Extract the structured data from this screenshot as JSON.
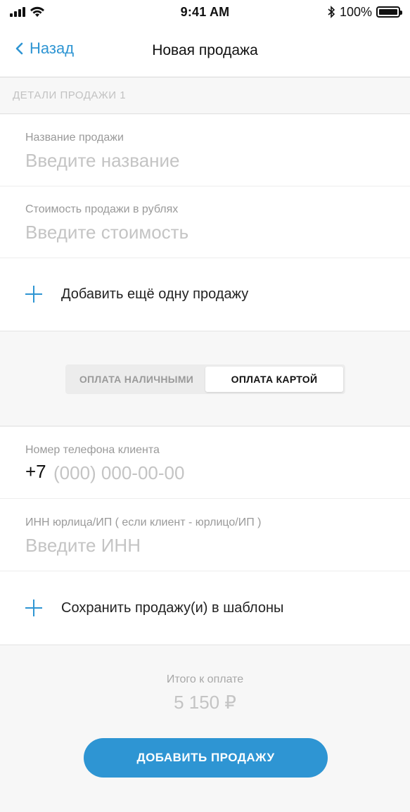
{
  "status_bar": {
    "time": "9:41 AM",
    "battery": "100%",
    "battery_level": 1.0
  },
  "nav": {
    "back_label": "Назад",
    "title": "Новая продажа"
  },
  "section": {
    "title": "ДЕТАЛИ ПРОДАЖИ 1"
  },
  "form": {
    "name": {
      "label": "Название продажи",
      "placeholder": "Введите название",
      "value": ""
    },
    "price": {
      "label": "Стоимость продажи в рублях",
      "placeholder": "Введите стоимость",
      "value": ""
    },
    "add_more_label": "Добавить ещё одну продажу"
  },
  "payment": {
    "options": [
      "ОПЛАТА НАЛИЧНЫМИ",
      "ОПЛАТА КАРТОЙ"
    ],
    "selected": "ОПЛАТА КАРТОЙ"
  },
  "client": {
    "phone": {
      "label": "Номер телефона клиента",
      "prefix": "+7",
      "placeholder": "(000) 000-00-00",
      "value": ""
    },
    "inn": {
      "label": "ИНН юрлица/ИП ( если клиент - юрлицо/ИП )",
      "placeholder": "Введите ИНН",
      "value": ""
    },
    "save_templates_label": "Сохранить продажу(и) в шаблоны"
  },
  "summary": {
    "total_label": "Итого к оплате",
    "total_value": "5 150 ₽",
    "submit_label": "ДОБАВИТЬ ПРОДАЖУ"
  },
  "colors": {
    "accent": "#2e95d3",
    "background": "#f7f7f7",
    "placeholder": "#c4c4c4"
  }
}
